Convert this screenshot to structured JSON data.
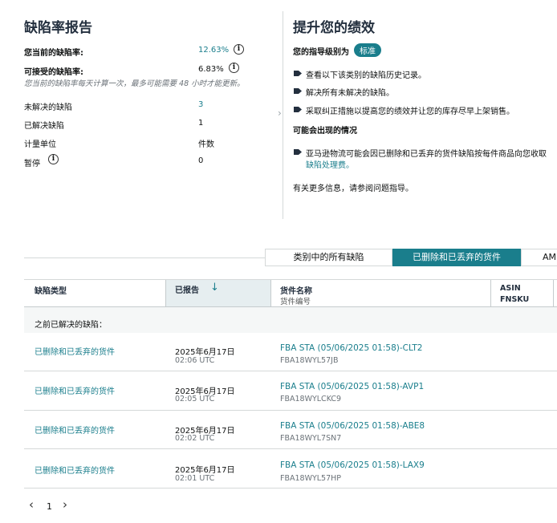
{
  "left": {
    "title": "缺陷率报告",
    "current_rate_label": "您当前的缺陷率:",
    "current_rate_value": "12.63%",
    "acceptable_rate_label": "可接受的缺陷率:",
    "acceptable_rate_value": "6.83%",
    "note": "您当前的缺陷率每天计算一次，最多可能需要 48 小时才能更新。",
    "stats": [
      {
        "label": "未解决的缺陷",
        "value": "3"
      },
      {
        "label": "已解决缺陷",
        "value": "1"
      },
      {
        "label": "计量单位",
        "value": "件数"
      },
      {
        "label": "暂停",
        "value": "0"
      }
    ]
  },
  "right": {
    "title": "提升您的绩效",
    "guidance_label": "您的指导级别为",
    "guidance_badge": "标准",
    "bullets": [
      "查看以下该类别的缺陷历史记录。",
      "解决所有未解决的缺陷。",
      "采取纠正措施以提高您的绩效并让您的库存尽早上架销售。"
    ],
    "possible_title": "可能会出现的情况",
    "possible_bullet_line1": "亚马逊物流可能会因已删除和已丢弃的货件缺陷按每件商品向您收取",
    "possible_bullet_line2": "缺陷处理费。",
    "more_info": "有关更多信息，请参阅问题指导。"
  },
  "tabs": [
    "类别中的所有缺陷",
    "已删除和已丢弃的货件",
    "AMI"
  ],
  "table": {
    "headers": {
      "defect_type": "缺陷类型",
      "reported": "已报告",
      "shipment_name": "货件名称",
      "shipment_id": "货件编号",
      "asin": "ASIN",
      "fnsku": "FNSKU"
    },
    "section_label": "之前已解决的缺陷：",
    "rows": [
      {
        "type": "已删除和已丢弃的货件",
        "date": "2025年6月17日",
        "time": "02:06 UTC",
        "name": "FBA STA (05/06/2025 01:58)-CLT2",
        "id": "FBA18WYL57JB"
      },
      {
        "type": "已删除和已丢弃的货件",
        "date": "2025年6月17日",
        "time": "02:05 UTC",
        "name": "FBA STA (05/06/2025 01:58)-AVP1",
        "id": "FBA18WYLCKC9"
      },
      {
        "type": "已删除和已丢弃的货件",
        "date": "2025年6月17日",
        "time": "02:02 UTC",
        "name": "FBA STA (05/06/2025 01:58)-ABE8",
        "id": "FBA18WYL7SN7"
      },
      {
        "type": "已删除和已丢弃的货件",
        "date": "2025年6月17日",
        "time": "02:01 UTC",
        "name": "FBA STA (05/06/2025 01:58)-LAX9",
        "id": "FBA18WYL57HP"
      }
    ]
  },
  "pagination": {
    "page": "1",
    "prev": "‹",
    "next": "›"
  },
  "icons": {
    "info": "i",
    "sort": "↓",
    "mid_chevron": "›"
  }
}
